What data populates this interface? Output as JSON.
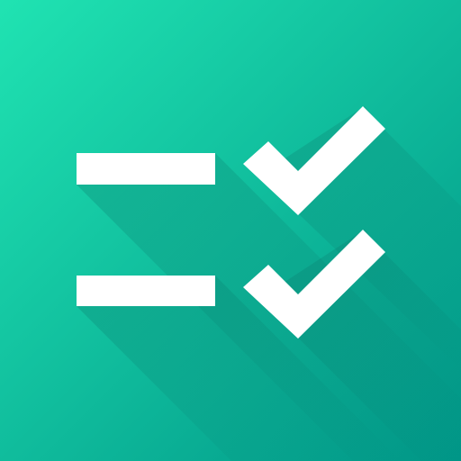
{
  "icon": {
    "name": "checklist-icon",
    "colors": {
      "background_top_left": "#20E3B2",
      "background_bottom_right": "#009687",
      "foreground": "#FFFFFF",
      "long_shadow": "#0A6F64"
    },
    "rows": [
      {
        "name": "first-item",
        "checked": true
      },
      {
        "name": "second-item",
        "checked": true
      }
    ]
  }
}
